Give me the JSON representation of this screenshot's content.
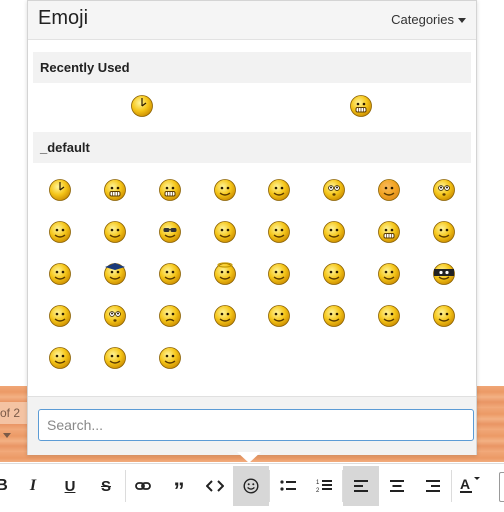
{
  "popup": {
    "title": "Emoji",
    "categories_label": "Categories"
  },
  "sections": {
    "recently_used": "Recently Used",
    "default": "_default"
  },
  "search": {
    "placeholder": "Search..."
  },
  "background": {
    "pager_text": "of 2"
  },
  "emoji_icons": {
    "recent": [
      "clock-smiley-icon",
      "grin-smiley-icon"
    ],
    "default": [
      "clock-smiley-icon",
      "big-grin-smiley-icon",
      "grin-smiley-icon",
      "thinking-hand-smiley-icon",
      "laugh-smiley-icon",
      "surprised-smiley-icon",
      "blush-smiley-icon",
      "popcorn-smiley-icon",
      "hands-up-smiley-icon",
      "content-smiley-icon",
      "cool-glasses-smiley-icon",
      "shocked-smiley-icon",
      "tongue-out-smiley-icon",
      "relieved-smiley-icon",
      "grimace-smiley-icon",
      "facepalm-smiley-icon",
      "waving-smiley-icon",
      "graduate-smiley-icon",
      "thumbs-up-smiley-icon",
      "angel-smiley-icon",
      "happy-smiley-icon",
      "thinking-smiley-icon",
      "rockon-smiley-icon",
      "ninja-smiley-icon",
      "dizzy-smiley-icon",
      "rolleyes-smiley-icon",
      "sad-smiley-icon",
      "shrug-smiley-icon",
      "romance-smiley-icon",
      "headphones-smiley-icon",
      "magnify-smiley-icon",
      "wall-bang-smiley-icon",
      "whistle-smiley-icon",
      "wink-smiley-icon",
      "cheer-smiley-icon"
    ]
  },
  "toolbar": {
    "buttons": [
      "bold-icon",
      "italic-icon",
      "underline-icon",
      "strikethrough-icon",
      "link-icon",
      "quote-icon",
      "code-icon",
      "emoji-icon",
      "bullet-list-icon",
      "numbered-list-icon",
      "align-left-icon",
      "align-center-icon",
      "align-right-icon",
      "text-color-icon"
    ],
    "active": [
      "emoji-icon",
      "align-left-icon"
    ]
  },
  "colors": {
    "accent_border": "#5b9bd5",
    "emoji_yellow": "#f5c518",
    "active_button": "#d7d7d7"
  }
}
